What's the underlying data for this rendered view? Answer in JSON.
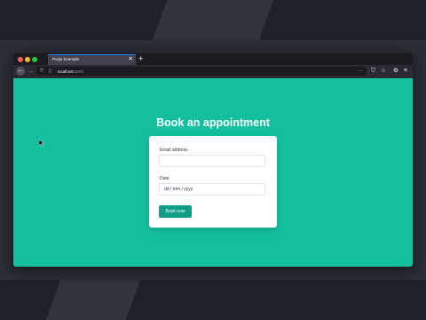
{
  "browser": {
    "tab_title": "Punjs Example",
    "tab_close": "✕",
    "new_tab": "+",
    "url_host": "localhost",
    "url_port": ":3000",
    "accent": "#0a84ff"
  },
  "page": {
    "heading": "Book an appointment",
    "background": "#14bf9f"
  },
  "form": {
    "email_label": "Email address",
    "email_value": "",
    "date_label": "Date",
    "date_value": "dd / mm / yyyy",
    "submit_label": "Book now",
    "button_color": "#0f9d88"
  }
}
